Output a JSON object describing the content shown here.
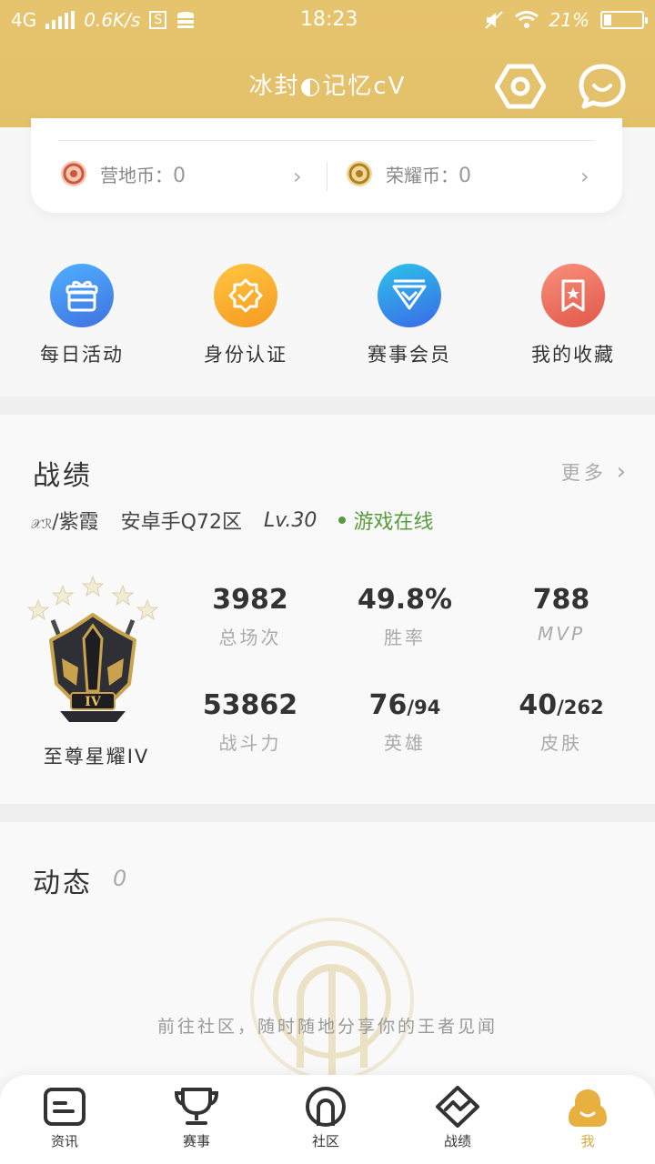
{
  "status_bar": {
    "network": "4G",
    "speed": "0.6K/s",
    "time": "18:23",
    "battery": "21%",
    "battery_level": 0.21,
    "sim_badge": "S"
  },
  "header": {
    "username": "冰封◐记忆cV",
    "settings_icon": "hexagon-settings-icon",
    "message_icon": "chat-bubble-icon"
  },
  "wallet": {
    "camp_coin_label": "营地币：",
    "camp_coin_value": "0",
    "honor_coin_label": "荣耀币：",
    "honor_coin_value": "0"
  },
  "shortcuts": [
    {
      "label": "每日活动",
      "icon": "gift-icon",
      "color": "#3f8fe0"
    },
    {
      "label": "身份认证",
      "icon": "verify-badge-icon",
      "color": "#f4a42c"
    },
    {
      "label": "赛事会员",
      "icon": "diamond-icon",
      "color": "#2f8ae6"
    },
    {
      "label": "我的收藏",
      "icon": "bookmark-star-icon",
      "color": "#ec6a58"
    }
  ],
  "record": {
    "title": "战绩",
    "more": "更多",
    "player_tag": "𝒳ℛ",
    "player_name": "/紫霞",
    "server": "安卓手Q72区",
    "level": "Lv.30",
    "online": "游戏在线",
    "rank": "至尊星耀IV",
    "rank_stars": 5,
    "stats": [
      {
        "value": "3982",
        "suffix": "",
        "label": "总场次"
      },
      {
        "value": "49.8%",
        "suffix": "",
        "label": "胜率"
      },
      {
        "value": "788",
        "suffix": "",
        "label": "MVP"
      },
      {
        "value": "53862",
        "suffix": "",
        "label": "战斗力"
      },
      {
        "value": "76",
        "suffix": "/94",
        "label": "英雄"
      },
      {
        "value": "40",
        "suffix": "/262",
        "label": "皮肤"
      }
    ]
  },
  "feed": {
    "title": "动态",
    "count": "0",
    "empty_text": "前往社区，随时随地分享你的王者见闻"
  },
  "tabs": [
    {
      "label": "资讯",
      "icon": "news-icon"
    },
    {
      "label": "赛事",
      "icon": "trophy-icon"
    },
    {
      "label": "社区",
      "icon": "community-icon"
    },
    {
      "label": "战绩",
      "icon": "record-chart-icon"
    },
    {
      "label": "我",
      "icon": "profile-icon"
    }
  ],
  "colors": {
    "header": "#e4c26b",
    "accent": "#d8a940",
    "online": "#5b9b3f"
  }
}
